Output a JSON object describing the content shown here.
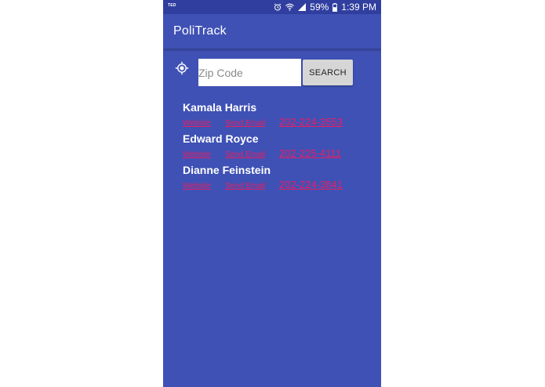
{
  "status_bar": {
    "carrier": "TED",
    "battery": "59%",
    "time": "1:39 PM",
    "icons": [
      "alarm-icon",
      "wifi-icon",
      "signal-icon",
      "battery-icon"
    ]
  },
  "app_bar": {
    "title": "PoliTrack"
  },
  "search": {
    "locate_icon": "gps-location-icon",
    "placeholder": "Zip Code",
    "value": "",
    "button_label": "SEARCH"
  },
  "representatives": [
    {
      "name": "Kamala Harris",
      "website_label": "Website",
      "email_label": "Send Email",
      "phone": "202-224-3553"
    },
    {
      "name": "Edward Royce",
      "website_label": "Website",
      "email_label": "Send Email",
      "phone": "202-225-4111"
    },
    {
      "name": "Dianne Feinstein",
      "website_label": "Website",
      "email_label": "Send Email",
      "phone": "202-224-3841"
    }
  ],
  "colors": {
    "primary": "#3f51b5",
    "primary_dark": "#303f9f",
    "accent": "#e91e63",
    "button_bg": "#d6d6d6"
  }
}
